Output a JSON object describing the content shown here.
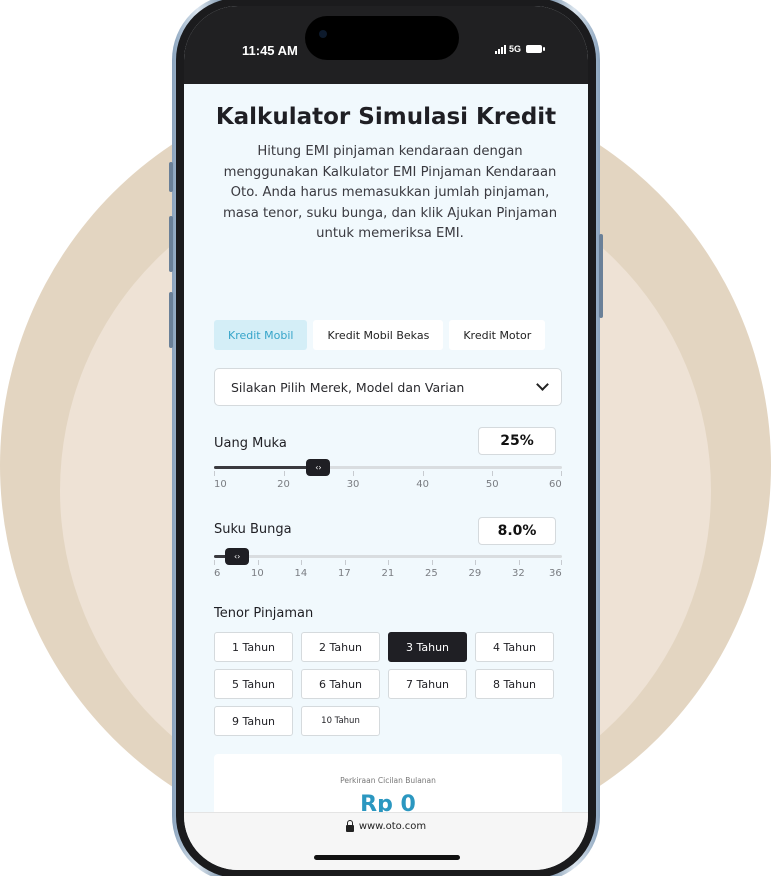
{
  "status_bar": {
    "time": "11:45 AM",
    "network": "5G"
  },
  "header": {
    "title": "Kalkulator Simulasi Kredit",
    "description": "Hitung EMI pinjaman kendaraan dengan menggunakan Kalkulator EMI Pinjaman Kendaraan Oto. Anda harus memasukkan jumlah pinjaman, masa tenor, suku bunga, dan klik Ajukan Pinjaman untuk memeriksa EMI."
  },
  "tabs": [
    {
      "label": "Kredit Mobil",
      "active": true
    },
    {
      "label": "Kredit Mobil Bekas",
      "active": false
    },
    {
      "label": "Kredit Motor",
      "active": false
    }
  ],
  "vehicle_select": {
    "placeholder": "Silakan Pilih Merek, Model dan Varian",
    "icon": "chevron-down-icon"
  },
  "down_payment": {
    "label": "Uang Muka",
    "value": "25%",
    "level": 25,
    "min": 10,
    "max": 60,
    "ticks": [
      "10",
      "20",
      "30",
      "40",
      "50",
      "60"
    ]
  },
  "interest_rate": {
    "label": "Suku Bunga",
    "value": "8.0%",
    "level": 8,
    "min": 6,
    "max": 36,
    "ticks": [
      "6",
      "10",
      "14",
      "17",
      "21",
      "25",
      "29",
      "32",
      "36"
    ]
  },
  "tenor": {
    "label": "Tenor Pinjaman",
    "options": [
      "1 Tahun",
      "2 Tahun",
      "3 Tahun",
      "4 Tahun",
      "5 Tahun",
      "6 Tahun",
      "7 Tahun",
      "8 Tahun",
      "9 Tahun",
      "10 Tahun"
    ],
    "selected": "3 Tahun"
  },
  "result": {
    "label": "Perkiraan Cicilan Bulanan",
    "value": "Rp 0"
  },
  "browser": {
    "url": "www.oto.com"
  },
  "colors": {
    "accent": "#2b97c0",
    "active_tab_bg": "#d4eef7",
    "dark": "#1f1f24",
    "background_circle": "#e3d5c1"
  }
}
